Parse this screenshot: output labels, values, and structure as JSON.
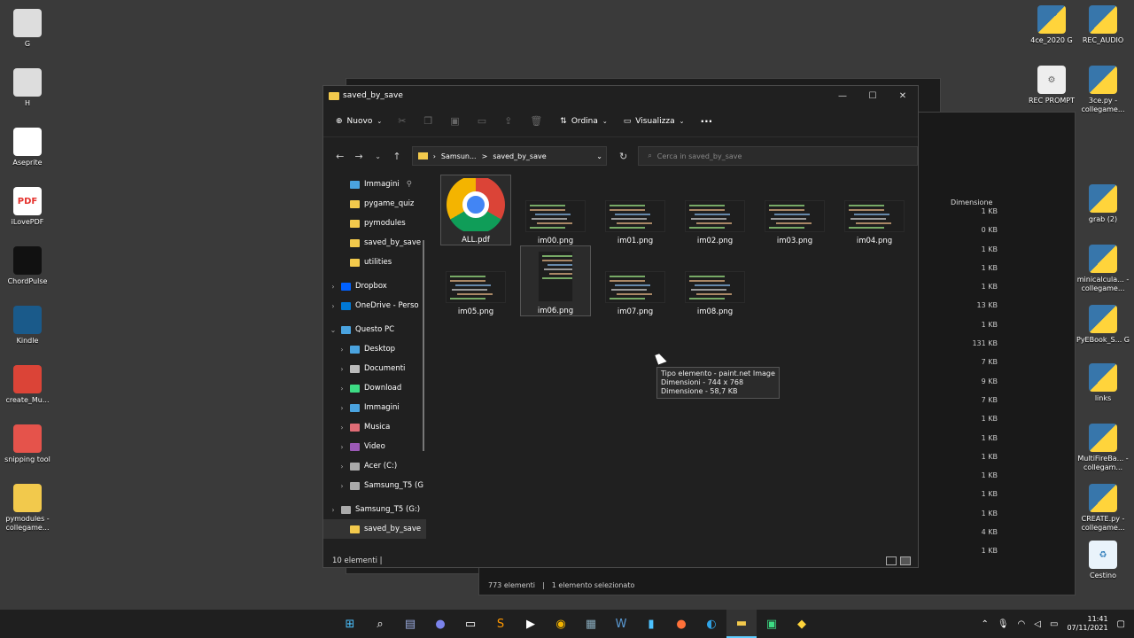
{
  "desktop": {
    "left_icons": [
      {
        "label": "G",
        "icon": "drive-icon"
      },
      {
        "label": "H",
        "icon": "drive-icon"
      },
      {
        "label": "Aseprite",
        "icon": "aseprite-icon"
      },
      {
        "label": "iLovePDF",
        "icon": "ilovepdf-icon"
      },
      {
        "label": "ChordPulse",
        "icon": "chordpulse-icon"
      },
      {
        "label": "Kindle",
        "icon": "kindle-icon"
      },
      {
        "label": "create_Mu...",
        "icon": "chrome-icon"
      },
      {
        "label": "snipping tool",
        "icon": "snipping-tool-icon"
      },
      {
        "label": "pymodules - collegame...",
        "icon": "folder-icon"
      }
    ],
    "right_icons": [
      {
        "label": "4ce_2020 G",
        "icon": "python-icon"
      },
      {
        "label": "REC_AUDIO",
        "icon": "python-icon"
      },
      {
        "label": "REC PROMPT",
        "icon": "settings-icon"
      },
      {
        "label": "3ce.py - collegame...",
        "icon": "python-icon"
      },
      {
        "label": "grab (2)",
        "icon": "python-icon"
      },
      {
        "label": "minicalcula... - collegame...",
        "icon": "python-icon"
      },
      {
        "label": "PyEBook_S... G",
        "icon": "python-icon"
      },
      {
        "label": "links",
        "icon": "python-icon"
      },
      {
        "label": "MultiFireBa... - collegam...",
        "icon": "python-icon"
      },
      {
        "label": "CREATE.py - collegame...",
        "icon": "python-icon"
      },
      {
        "label": "Cestino",
        "icon": "recycle-bin-icon"
      }
    ]
  },
  "explorer": {
    "title": "saved_by_save",
    "toolbar": {
      "new_label": "Nuovo",
      "sort_label": "Ordina",
      "view_label": "Visualizza",
      "more_label": "···"
    },
    "address": {
      "segment1": "Samsun...",
      "sep": ">",
      "segment2": "saved_by_save"
    },
    "search_placeholder": "Cerca in saved_by_save",
    "sidebar": [
      {
        "label": "Immagini",
        "type": "image",
        "pinned": true,
        "indent": 1
      },
      {
        "label": "pygame_quiz",
        "type": "folder",
        "indent": 1
      },
      {
        "label": "pymodules",
        "type": "folder",
        "indent": 1
      },
      {
        "label": "saved_by_save",
        "type": "folder",
        "indent": 1
      },
      {
        "label": "utilities",
        "type": "folder",
        "indent": 1
      },
      {
        "label": "Dropbox",
        "type": "dropbox",
        "indent": 0,
        "chevron": ">"
      },
      {
        "label": "OneDrive - Perso",
        "type": "onedrive",
        "indent": 0,
        "chevron": ">"
      },
      {
        "label": "Questo PC",
        "type": "pc",
        "indent": 0,
        "chevron": "v"
      },
      {
        "label": "Desktop",
        "type": "desktop",
        "indent": 1,
        "chevron": ">"
      },
      {
        "label": "Documenti",
        "type": "docs",
        "indent": 1,
        "chevron": ">"
      },
      {
        "label": "Download",
        "type": "download",
        "indent": 1,
        "chevron": ">"
      },
      {
        "label": "Immagini",
        "type": "image",
        "indent": 1,
        "chevron": ">"
      },
      {
        "label": "Musica",
        "type": "music",
        "indent": 1,
        "chevron": ">"
      },
      {
        "label": "Video",
        "type": "video",
        "indent": 1,
        "chevron": ">"
      },
      {
        "label": "Acer (C:)",
        "type": "drive",
        "indent": 1,
        "chevron": ">"
      },
      {
        "label": "Samsung_T5 (G",
        "type": "drive",
        "indent": 1,
        "chevron": ">"
      },
      {
        "label": "Samsung_T5 (G:)",
        "type": "drive",
        "indent": 0,
        "chevron": ">"
      },
      {
        "label": "saved_by_save",
        "type": "folder",
        "indent": 1,
        "selected": true
      }
    ],
    "files": [
      {
        "name": "ALL.pdf",
        "kind": "chrome"
      },
      {
        "name": "im00.png",
        "kind": "code"
      },
      {
        "name": "im01.png",
        "kind": "code"
      },
      {
        "name": "im02.png",
        "kind": "code"
      },
      {
        "name": "im03.png",
        "kind": "code"
      },
      {
        "name": "im04.png",
        "kind": "code"
      },
      {
        "name": "im05.png",
        "kind": "code"
      },
      {
        "name": "im06.png",
        "kind": "code"
      },
      {
        "name": "im07.png",
        "kind": "code"
      },
      {
        "name": "im08.png",
        "kind": "code"
      }
    ],
    "tooltip": {
      "line1": "Tipo elemento - paint.net Image",
      "line2": "Dimensioni - 744 x 768",
      "line3": "Dimensione - 58,7 KB"
    },
    "status": "10 elementi"
  },
  "background_window": {
    "column_header": "Dimensione",
    "sizes": [
      "1 KB",
      "0 KB",
      "1 KB",
      "1 KB",
      "1 KB",
      "13 KB",
      "1 KB",
      "131 KB",
      "7 KB",
      "9 KB",
      "7 KB",
      "1 KB",
      "1 KB",
      "1 KB",
      "1 KB",
      "1 KB",
      "1 KB",
      "4 KB",
      "1 KB"
    ],
    "status_count": "773 elementi",
    "status_selected": "1 elemento selezionato"
  },
  "taskbar": {
    "time": "11:41",
    "date": "07/11/2021"
  }
}
